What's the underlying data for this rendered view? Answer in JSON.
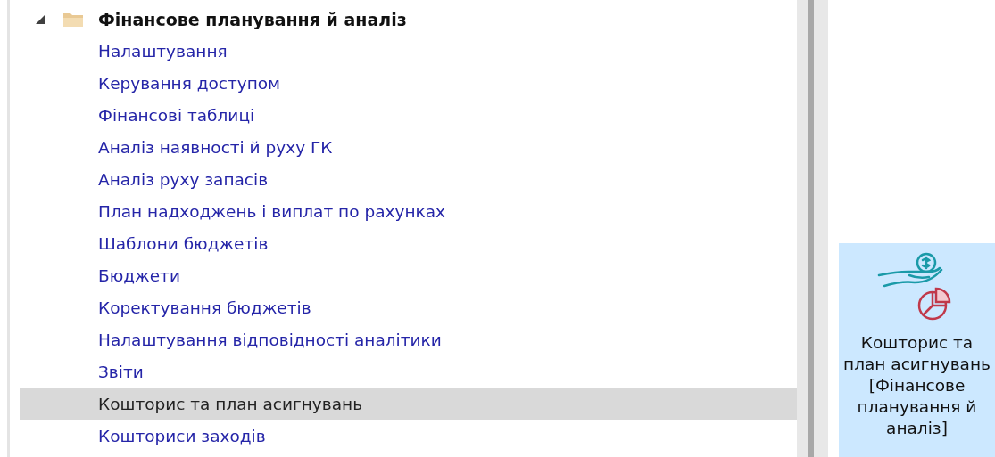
{
  "tree": {
    "title": "Фінансове планування й аналіз",
    "expanded": true,
    "items": [
      {
        "label": "Налаштування",
        "selected": false
      },
      {
        "label": "Керування доступом",
        "selected": false
      },
      {
        "label": "Фінансові таблиці",
        "selected": false
      },
      {
        "label": "Аналіз наявності й руху ГК",
        "selected": false
      },
      {
        "label": "Аналіз руху запасів",
        "selected": false
      },
      {
        "label": "План надходжень і виплат по рахунках",
        "selected": false
      },
      {
        "label": "Шаблони бюджетів",
        "selected": false
      },
      {
        "label": "Бюджети",
        "selected": false
      },
      {
        "label": "Коректування бюджетів",
        "selected": false
      },
      {
        "label": "Налаштування відповідності аналітики",
        "selected": false
      },
      {
        "label": "Звіти",
        "selected": false
      },
      {
        "label": "Кошторис та план асигнувань",
        "selected": true
      },
      {
        "label": "Кошториси заходів",
        "selected": false
      }
    ]
  },
  "tile": {
    "selected": true,
    "lines": [
      "Кошторис та",
      "план асигнувань",
      "[Фінансове",
      "планування й",
      "аналіз]"
    ]
  }
}
